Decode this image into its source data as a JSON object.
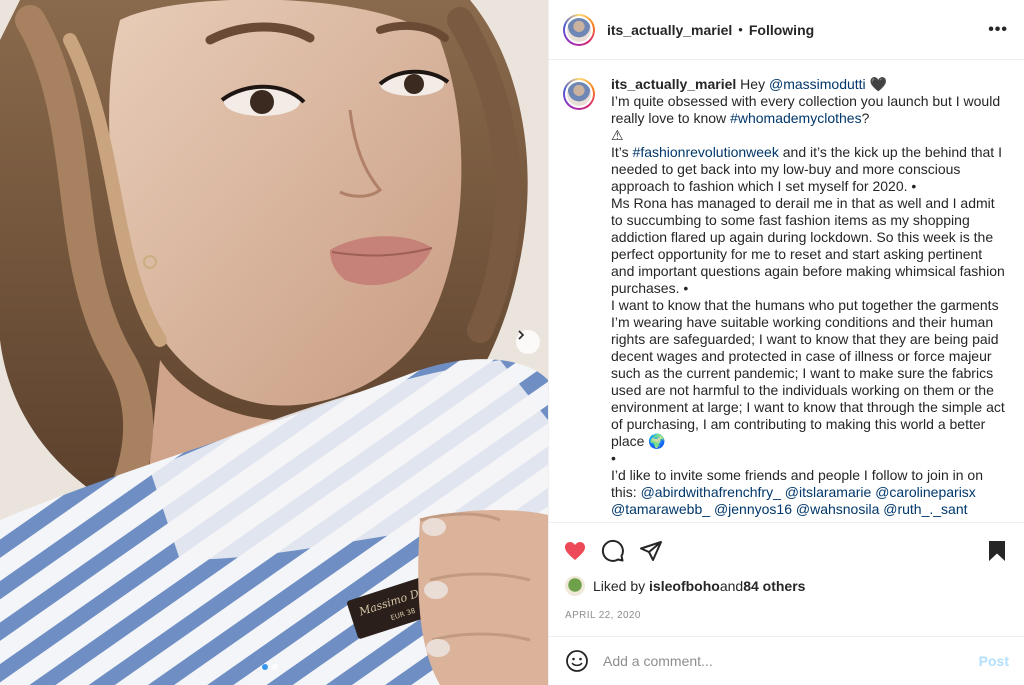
{
  "post": {
    "username": "its_actually_mariel",
    "separator": "•",
    "follow_status": "Following",
    "more_label": "•••"
  },
  "caption": {
    "username": "its_actually_mariel",
    "line1_text": " Hey ",
    "mention1": "@massimodutti",
    "line1_end": " 🖤",
    "line2": "I’m quite obsessed with every collection you launch but I would really love to know ",
    "hashtag1": "#whomademyclothes",
    "line2_end": "?",
    "warning": "⚠",
    "p3_start": "It’s ",
    "hashtag2": "#fashionrevolutionweek",
    "p3_rest": " and it’s the kick up the behind that I needed to get back into my low-buy and more conscious approach to fashion which I set myself for 2020. •",
    "p4": "Ms Rona has managed to derail me in that as well and I admit to succumbing to some fast fashion items as my shopping addiction flared up again during lockdown. So this week is the perfect opportunity for me to reset and start asking pertinent and important questions again before making whimsical fashion purchases. •",
    "p5": "I want to know that the humans who put together the garments I’m wearing have suitable working conditions and their human rights are safeguarded; I want to know that they are being paid decent wages and protected in case of illness or force majeur such as the current pandemic; I want to make sure the fabrics used are not harmful to the individuals working on them or the environment at large; I want to know that through the simple act of purchasing, I am contributing to making this world a better place 🌍",
    "bullet": "•",
    "p6": "I’d like to invite some friends and people I follow to join in on this: ",
    "mentions": [
      "@abirdwithafrenchfry_",
      "@itslaramarie",
      "@carolineparisx",
      "@tamarawebb_",
      "@jennyos16",
      "@wahsnosila",
      "@ruth_._sant"
    ]
  },
  "likes": {
    "prefix": "Liked by ",
    "user": "isleofboho",
    "middle": " and ",
    "others": "84 others"
  },
  "date": "APRIL 22, 2020",
  "comment": {
    "placeholder": "Add a comment...",
    "post_label": "Post"
  },
  "colors": {
    "like_red": "#ed4956",
    "link_blue": "#00376b",
    "post_disabled": "#b2dffc",
    "carousel_active": "#3897f0"
  },
  "icons": [
    "heart-filled-icon",
    "comment-icon",
    "share-icon",
    "bookmark-filled-icon",
    "emoji-icon",
    "chevron-right-icon",
    "more-icon"
  ]
}
